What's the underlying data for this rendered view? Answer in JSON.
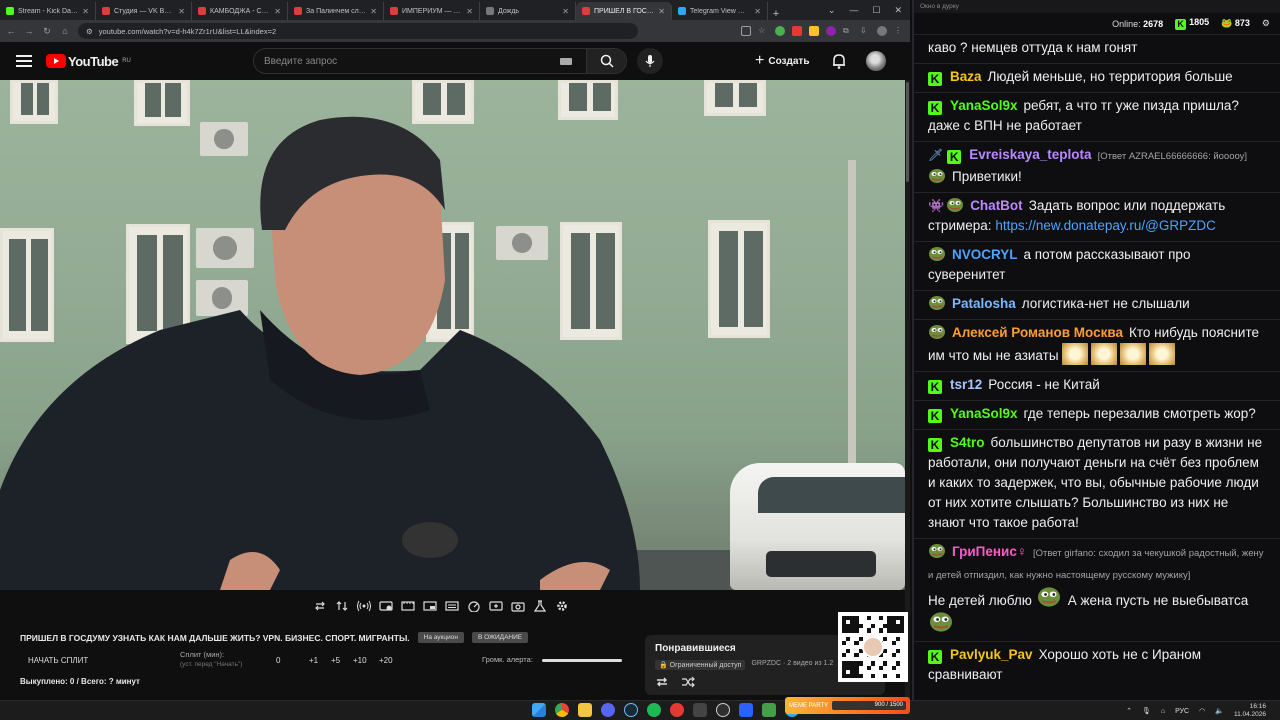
{
  "browser": {
    "tabs": [
      {
        "label": "Stream - Kick Dashboard",
        "color": "#53fc18"
      },
      {
        "label": "Студия — VK Видео Live",
        "color": "#e03c3c"
      },
      {
        "label": "КАМБОДЖА - Столица",
        "color": "#e03c3c"
      },
      {
        "label": "За Палинчем следит и р",
        "color": "#e03c3c"
      },
      {
        "label": "ИМПЕРИУМ — НЕ РОС",
        "color": "#e03c3c"
      },
      {
        "label": "Дождь",
        "color": "#777777"
      },
      {
        "label": "ПРИШЕЛ В ГОСДУМУ",
        "color": "#e03c3c"
      },
      {
        "label": "Telegram View @dvac",
        "color": "#2aabee"
      }
    ],
    "new_tab": "+",
    "url": "youtube.com/watch?v=d-h4k7Zr1rU&list=LL&index=2"
  },
  "youtube": {
    "logo_text": "YouTube",
    "region": "RU",
    "search_placeholder": "Введите запрос",
    "create_label": "Создать"
  },
  "video": {
    "title": "ПРИШЕЛ В ГОСДУМУ УЗНАТЬ КАК НАМ ДАЛЬШЕ ЖИТЬ? VPN. БИЗНЕС. СПОРТ. МИГРАНТЫ.",
    "pill1": "На аукцион",
    "pill2": "В ОЖИДАНИЕ"
  },
  "split": {
    "start_label": "НАЧАТЬ СПЛИТ",
    "minutes_label": "Сплит (мин):",
    "minutes_hint": "(уст. перед \"Начать\")",
    "value": "0",
    "increments": [
      "+1",
      "+5",
      "+10",
      "+20"
    ],
    "alert_volume_label": "Громк. алерта:",
    "bought": "Выкуплено: 0 / Всего: ? минут"
  },
  "liked_panel": {
    "title": "Понравившиеся",
    "access": "Ограниченный доступ",
    "meta": "GRPZDC · 2 видео из 1.2"
  },
  "chat": {
    "window_title": "Окно в дурку",
    "online_label": "Online:",
    "online_count": "2678",
    "kick_count": "1805",
    "pepe_count": "873",
    "messages": [
      {
        "nick": "",
        "color": "#efeff1",
        "badge": "none",
        "reply": "",
        "text": "каво ? немцев оттуда к нам гонят"
      },
      {
        "nick": "Baza",
        "color": "#f5c518",
        "badge": "kick",
        "reply": "",
        "text": "Людей меньше, но территория больше"
      },
      {
        "nick": "YanaSol9x",
        "color": "#53fc18",
        "badge": "kick",
        "reply": "",
        "text": "ребят, а что тг уже пизда пришла? даже с ВПН не работает"
      },
      {
        "nick": "Evreiskaya_teplota",
        "color": "#b98aff",
        "badge": "sword-kick",
        "reply": "[Ответ AZRAEL66666666: йооооу]",
        "text": "Приветики!"
      },
      {
        "nick": "ChatBot",
        "color": "#b98aff",
        "badge": "bot",
        "reply": "",
        "text": "Задать вопрос или поддержать стримера:",
        "link": "https://new.donatepay.ru/@GRPZDC"
      },
      {
        "nick": "NVOCRYL",
        "color": "#4da3ff",
        "badge": "pepe",
        "reply": "",
        "text": "а потом рассказывают про суверенитет"
      },
      {
        "nick": "Patalosha",
        "color": "#7ab8ff",
        "badge": "pepe",
        "reply": "",
        "text": "логистика-нет не слышали"
      },
      {
        "nick": "Алексей Романов Москва",
        "color": "#ff9d2e",
        "badge": "pepe",
        "reply": "",
        "text": "Кто нибудь поясните им что мы не азиаты"
      },
      {
        "nick": "tsr12",
        "color": "#a7c5ff",
        "badge": "kick",
        "reply": "",
        "text": "Россия - не Китай"
      },
      {
        "nick": "YanaSol9x",
        "color": "#53fc18",
        "badge": "kick",
        "reply": "",
        "text": "где теперь перезалив смотреть жор?"
      },
      {
        "nick": "S4tro",
        "color": "#53fc18",
        "badge": "kick",
        "reply": "",
        "text": "большинство депутатов ни разу в жизни не работали, они получают деньги на счёт без проблем и каких то задержек, что вы, обычные рабочие люди от них хотите слышать? Большинство из них не знают что такое работа!"
      },
      {
        "nick": "ГриПенис♀",
        "color": "#ff5ac8",
        "badge": "pepe",
        "reply": "[Ответ girfano: сходил за чекушкой радостный, жену и детей отпиздил, как нужно настоящему русскому мужику]",
        "text": "Не детей люблю",
        "text2": "А жена пусть не выебыватса"
      },
      {
        "nick": "Pavlyuk_Pav",
        "color": "#f5c518",
        "badge": "kick",
        "reply": "",
        "text": "Хорошо хоть не с Ираном сравнивают"
      }
    ]
  },
  "taskbar": {
    "meme_label": "MEME PARTY",
    "meme_progress": "900 / 1500",
    "lang": "РУС",
    "time": "16:16",
    "date": "11.04.2026"
  }
}
